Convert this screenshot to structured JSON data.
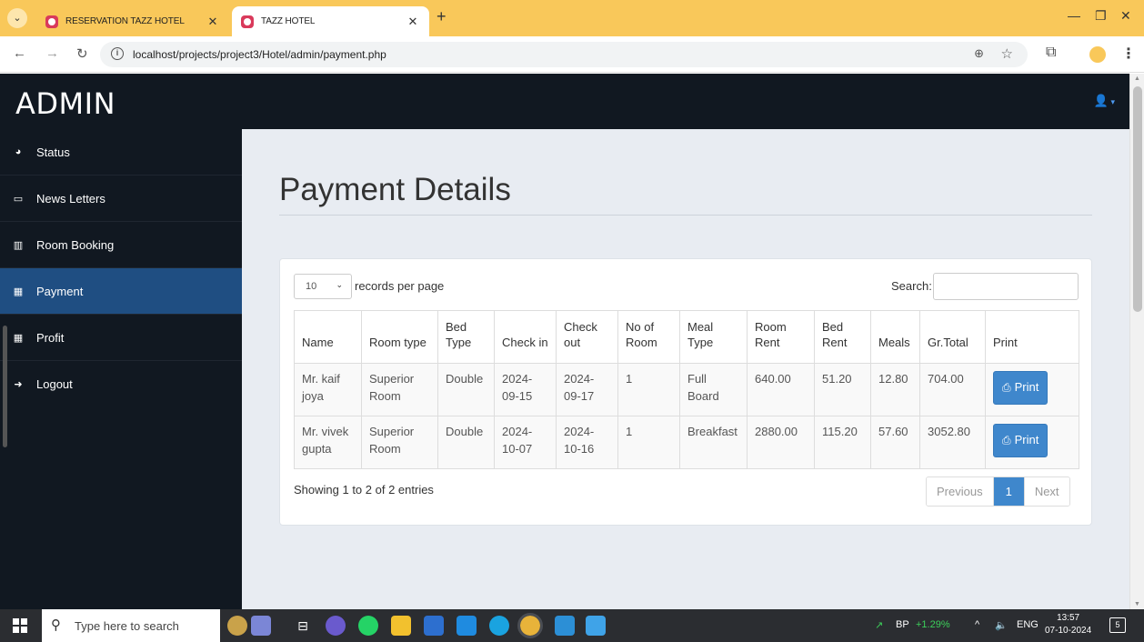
{
  "browser": {
    "tabs": [
      {
        "title": "RESERVATION TAZZ HOTEL",
        "active": false
      },
      {
        "title": "TAZZ HOTEL",
        "active": true
      }
    ],
    "url": "localhost/projects/project3/Hotel/admin/payment.php"
  },
  "header": {
    "brand": "ADMIN"
  },
  "sidebar": {
    "items": [
      {
        "label": "Status",
        "icon": "dashboard-icon"
      },
      {
        "label": "News Letters",
        "icon": "monitor-icon"
      },
      {
        "label": "Room Booking",
        "icon": "bar-chart-icon"
      },
      {
        "label": "Payment",
        "icon": "grid-icon",
        "active": true
      },
      {
        "label": "Profit",
        "icon": "grid-icon"
      },
      {
        "label": "Logout",
        "icon": "sign-out-icon"
      }
    ]
  },
  "main": {
    "title": "Payment Details",
    "length_value": "10",
    "length_label": "records per page",
    "search_label": "Search:",
    "table": {
      "headers": [
        "Name",
        "Room type",
        "Bed Type",
        "Check in",
        "Check out",
        "No of Room",
        "Meal Type",
        "Room Rent",
        "Bed Rent",
        "Meals",
        "Gr.Total",
        "Print"
      ],
      "rows": [
        {
          "name": "Mr. kaif joya",
          "room_type": "Superior Room",
          "bed_type": "Double",
          "check_in": "2024-09-15",
          "check_out": "2024-09-17",
          "rooms": "1",
          "meal_type": "Full Board",
          "room_rent": "640.00",
          "bed_rent": "51.20",
          "meals": "12.80",
          "total": "704.00",
          "print": "Print"
        },
        {
          "name": "Mr. vivek gupta",
          "room_type": "Superior Room",
          "bed_type": "Double",
          "check_in": "2024-10-07",
          "check_out": "2024-10-16",
          "rooms": "1",
          "meal_type": "Breakfast",
          "room_rent": "2880.00",
          "bed_rent": "115.20",
          "meals": "57.60",
          "total": "3052.80",
          "print": "Print"
        }
      ]
    },
    "info": "Showing 1 to 2 of 2 entries",
    "pager": {
      "previous": "Previous",
      "current": "1",
      "next": "Next"
    }
  },
  "taskbar": {
    "search_placeholder": "Type here to search",
    "stock": "BP",
    "stock_change": "+1.29%",
    "lang": "ENG",
    "time": "13:57",
    "date": "07-10-2024",
    "notifications": "5"
  },
  "colors": {
    "tabbar": "#f9c85a",
    "admin_dark": "#111821",
    "sidebar_active": "#1f4e82",
    "primary": "#3f87cc",
    "content_bg": "#e8ecf2"
  }
}
